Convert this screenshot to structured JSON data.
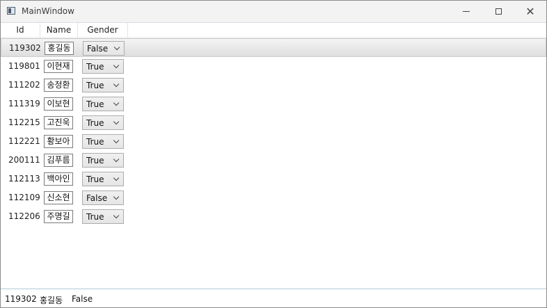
{
  "window": {
    "title": "MainWindow"
  },
  "grid": {
    "columns": [
      "Id",
      "Name",
      "Gender"
    ],
    "rows": [
      {
        "id": "119302",
        "name": "홍길동",
        "gender": "False"
      },
      {
        "id": "119801",
        "name": "이현재",
        "gender": "True"
      },
      {
        "id": "111202",
        "name": "송정환",
        "gender": "True"
      },
      {
        "id": "111319",
        "name": "이보현",
        "gender": "True"
      },
      {
        "id": "112215",
        "name": "고진욱",
        "gender": "True"
      },
      {
        "id": "112221",
        "name": "황보아",
        "gender": "True"
      },
      {
        "id": "200111",
        "name": "김푸름",
        "gender": "True"
      },
      {
        "id": "112113",
        "name": "백아인",
        "gender": "True"
      },
      {
        "id": "112109",
        "name": "신소현",
        "gender": "False"
      },
      {
        "id": "112206",
        "name": "주명길",
        "gender": "True"
      }
    ],
    "selected_index": 0
  },
  "status": {
    "id": "119302",
    "name": "홍길동",
    "gender": "False"
  },
  "colors": {
    "selected_row": "#e6e6e6",
    "status_border": "#aecbd6"
  }
}
